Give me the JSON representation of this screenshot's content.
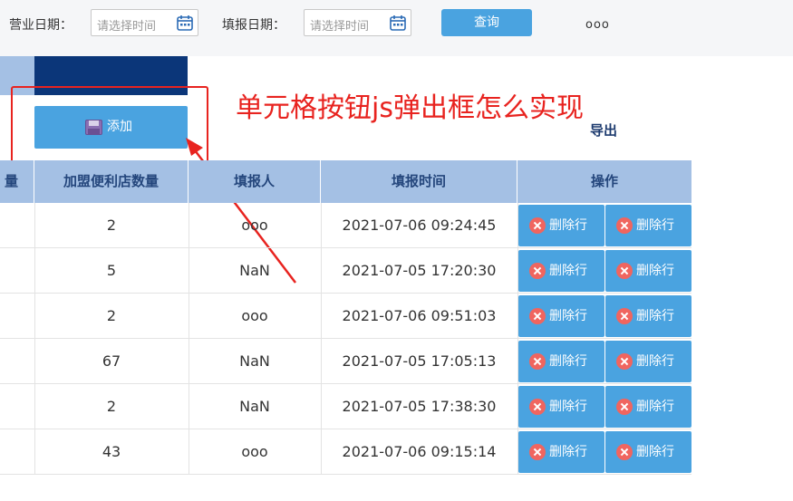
{
  "filters": {
    "business_date_label": "营业日期：",
    "report_date_label": "填报日期：",
    "date_placeholder": "请选择时间",
    "query_label": "查询",
    "more": "ooo"
  },
  "toolbar": {
    "add_label": "添加",
    "export_label": "导出"
  },
  "annotation": {
    "text": "单元格按钮js弹出框怎么实现"
  },
  "table": {
    "headers": [
      "量",
      "加盟便利店数量",
      "填报人",
      "填报时间",
      "操作"
    ],
    "delete_label": "删除行",
    "rows": [
      {
        "count": "2",
        "reporter": "ooo",
        "time": "2021-07-06 09:24:45"
      },
      {
        "count": "5",
        "reporter": "NaN",
        "time": "2021-07-05 17:20:30"
      },
      {
        "count": "2",
        "reporter": "ooo",
        "time": "2021-07-06 09:51:03"
      },
      {
        "count": "67",
        "reporter": "NaN",
        "time": "2021-07-05 17:05:13"
      },
      {
        "count": "2",
        "reporter": "NaN",
        "time": "2021-07-05 17:38:30"
      },
      {
        "count": "43",
        "reporter": "ooo",
        "time": "2021-07-06 09:15:14"
      }
    ]
  },
  "colors": {
    "accent": "#4aa3e0",
    "header": "#a4c0e4",
    "navy": "#0b3679",
    "annotation": "#e8231f"
  }
}
